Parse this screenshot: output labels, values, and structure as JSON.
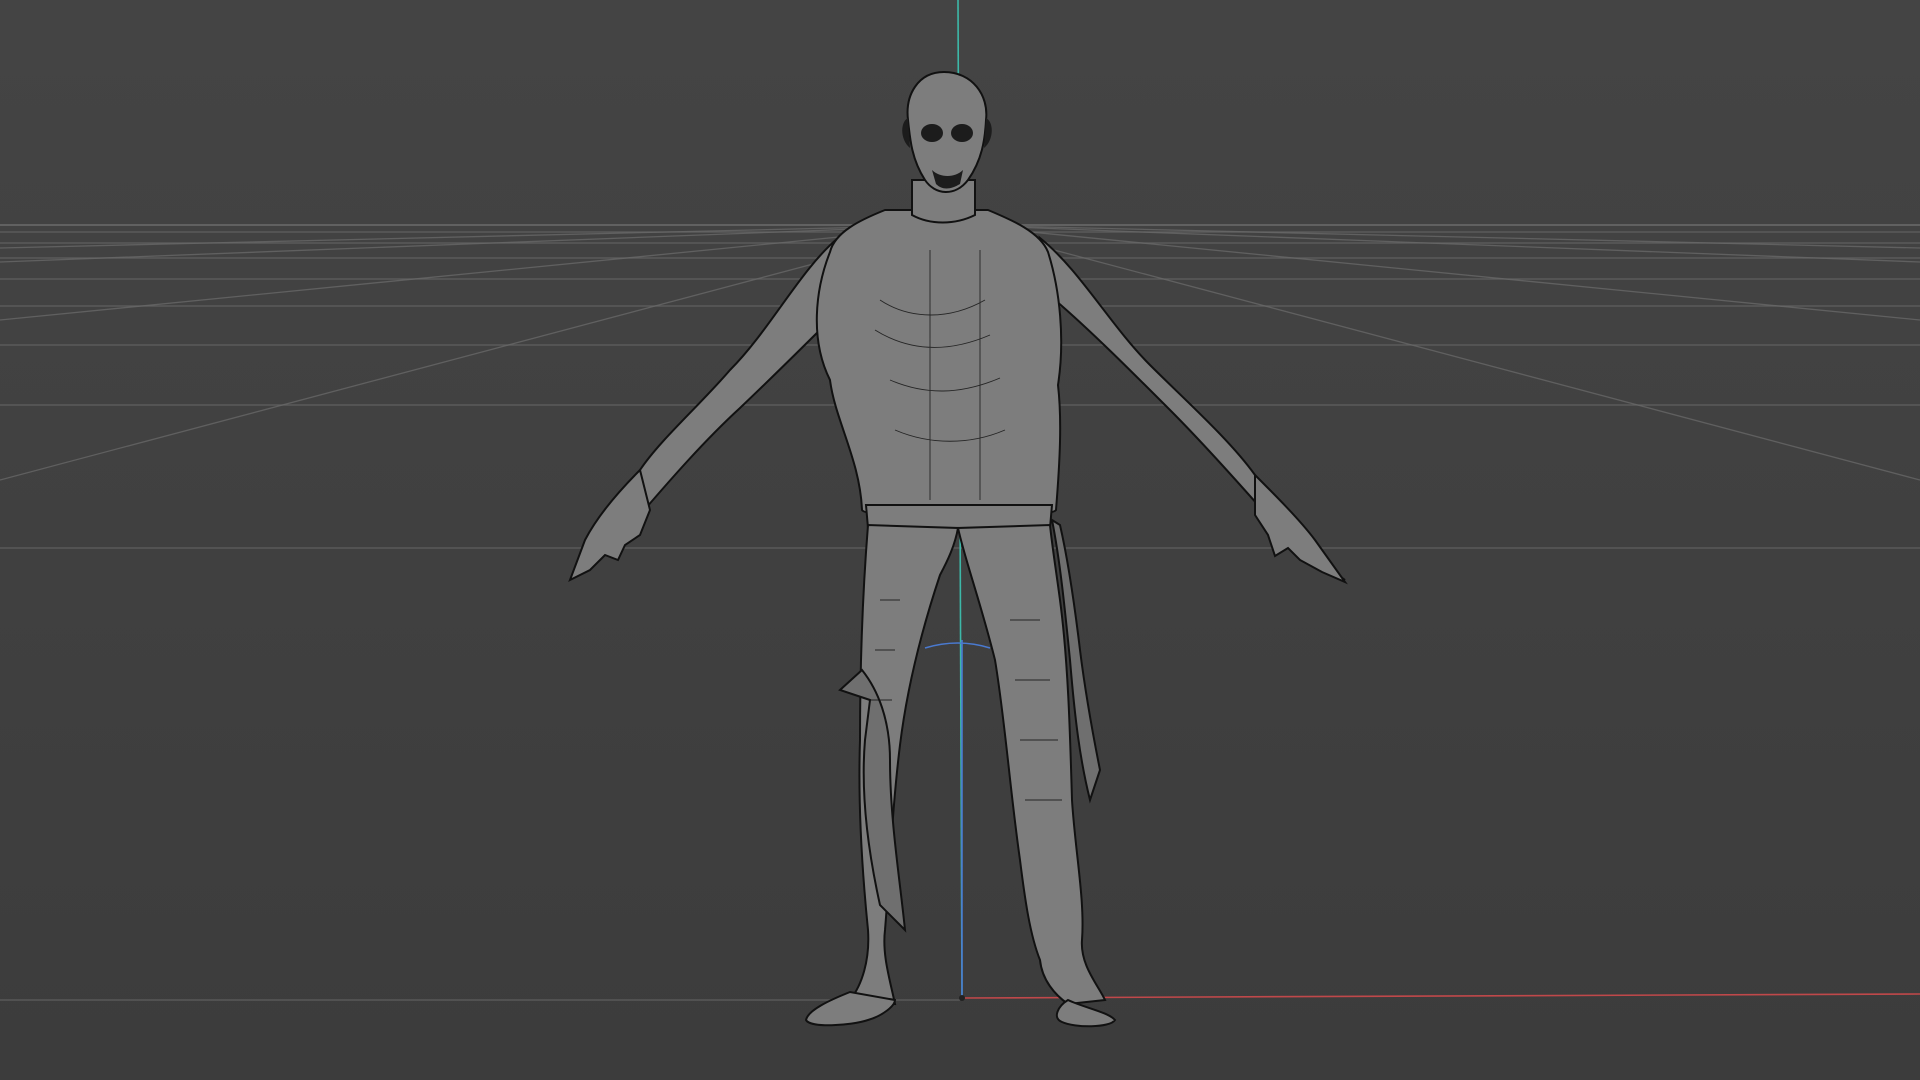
{
  "viewport": {
    "mode": "perspective",
    "shading": "wireframe-on-shaded",
    "background_color": "#414141",
    "grid_color": "#6a6a6a",
    "axis_colors": {
      "x": "#c0484a",
      "y": "#3db8a8",
      "z": "#4a7ad0"
    }
  },
  "model": {
    "kind": "humanoid character",
    "pose": "A-pose",
    "mesh_color": "#7d7d7d",
    "wire_color": "#151515"
  }
}
